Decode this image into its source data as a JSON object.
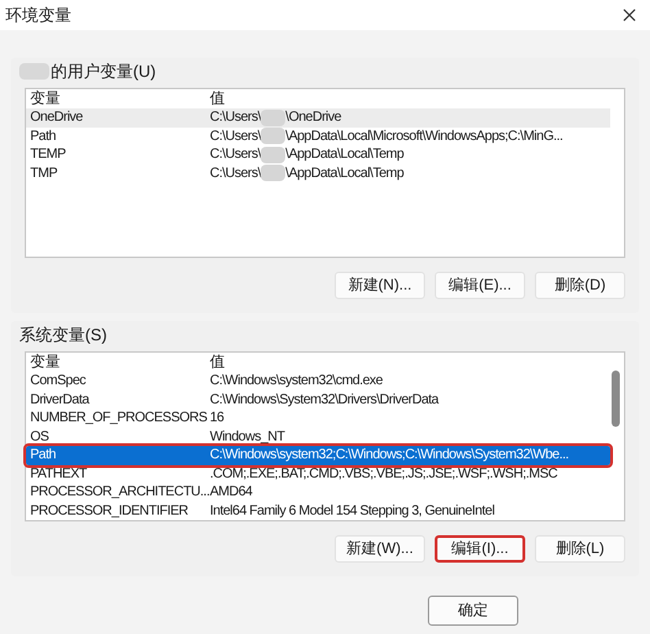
{
  "window": {
    "title": "环境变量"
  },
  "user_section": {
    "label": "的用户变量(U)",
    "redacted_prefix": true,
    "columns": [
      "变量",
      "值"
    ],
    "rows": [
      {
        "name": "OneDrive",
        "value_before": "C:\\Users\\",
        "redacted": true,
        "value_after": "\\OneDrive",
        "selected": false,
        "hovered": true
      },
      {
        "name": "Path",
        "value_before": "C:\\Users\\",
        "redacted": true,
        "value_after": "\\AppData\\Local\\Microsoft\\WindowsApps;C:\\MinG...",
        "selected": false,
        "hovered": false
      },
      {
        "name": "TEMP",
        "value_before": "C:\\Users\\",
        "redacted": true,
        "value_after": "\\AppData\\Local\\Temp",
        "selected": false,
        "hovered": false
      },
      {
        "name": "TMP",
        "value_before": "C:\\Users\\",
        "redacted": true,
        "value_after": "\\AppData\\Local\\Temp",
        "selected": false,
        "hovered": false
      }
    ],
    "buttons": [
      {
        "label": "新建(N)...",
        "highlighted": false
      },
      {
        "label": "编辑(E)...",
        "highlighted": false
      },
      {
        "label": "删除(D)",
        "highlighted": false
      }
    ]
  },
  "system_section": {
    "label": "系统变量(S)",
    "columns": [
      "变量",
      "值"
    ],
    "rows": [
      {
        "name": "ComSpec",
        "value_before": "C:\\Windows\\system32\\cmd.exe",
        "selected": false
      },
      {
        "name": "DriverData",
        "value_before": "C:\\Windows\\System32\\Drivers\\DriverData",
        "selected": false
      },
      {
        "name": "NUMBER_OF_PROCESSORS",
        "value_before": "16",
        "selected": false
      },
      {
        "name": "OS",
        "value_before": "Windows_NT",
        "selected": false
      },
      {
        "name": "Path",
        "value_before": "C:\\Windows\\system32;C:\\Windows;C:\\Windows\\System32\\Wbe...",
        "selected": true
      },
      {
        "name": "PATHEXT",
        "value_before": ".COM;.EXE;.BAT;.CMD;.VBS;.VBE;.JS;.JSE;.WSF;.WSH;.MSC",
        "selected": false
      },
      {
        "name": "PROCESSOR_ARCHITECTU...",
        "value_before": "AMD64",
        "selected": false
      },
      {
        "name": "PROCESSOR_IDENTIFIER",
        "value_before": "Intel64 Family 6 Model 154 Stepping 3, GenuineIntel",
        "selected": false
      }
    ],
    "buttons": [
      {
        "label": "新建(W)...",
        "highlighted": false
      },
      {
        "label": "编辑(I)...",
        "highlighted": true
      },
      {
        "label": "删除(L)",
        "highlighted": false
      }
    ]
  },
  "footer_buttons": [
    {
      "label": "确定"
    }
  ]
}
